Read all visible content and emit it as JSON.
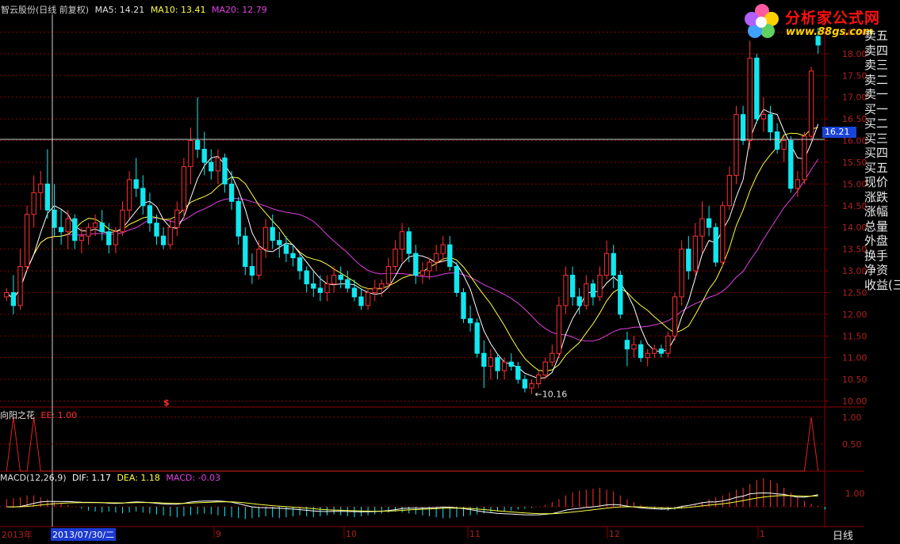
{
  "header": {
    "title": "智云股份(日线 前复权)",
    "ma5": "MA5: 14.21",
    "ma10": "MA10: 13.41",
    "ma20": "MA20: 12.79"
  },
  "logo": {
    "text": "分析家公式网",
    "url": "www.88gs.com"
  },
  "side_panel": {
    "items": [
      "卖五",
      "卖四",
      "卖三",
      "卖二",
      "卖一",
      "买一",
      "买二",
      "买三",
      "买四",
      "买五",
      "现价",
      "涨跌",
      "涨幅",
      "总量",
      "外盘",
      "换手",
      "净资",
      "收益(三"
    ]
  },
  "price_tag": "16.21",
  "low_label": "←10.16",
  "marker": "$",
  "indicator": {
    "name": "向阳之花",
    "value": "EE: 1.00"
  },
  "macd_header": {
    "name": "MACD(12,26,9)",
    "dif": "DIF: 1.17",
    "dea": "DEA: 1.18",
    "macd": "MACD: -0.03"
  },
  "timeline": {
    "year": "2013年",
    "date": "2013/07/30/二",
    "months": [
      "9",
      "10",
      "11",
      "12",
      "1"
    ],
    "period": "日线"
  },
  "colors": {
    "up": "#ff3030",
    "down": "#10e8f0",
    "ma5": "#ffffff",
    "ma10": "#ffff40",
    "ma20": "#e040e0",
    "grid": "#8b0000",
    "indicator": "#e02020"
  },
  "chart_data": {
    "type": "candlestick",
    "price_axis": {
      "ticks": [
        "18.50",
        "18.00",
        "17.50",
        "17.00",
        "16.50",
        "16.00",
        "15.50",
        "15.00",
        "14.50",
        "14.00",
        "13.50",
        "13.00",
        "12.50",
        "12.00",
        "11.50",
        "11.00",
        "10.50",
        "10.00"
      ],
      "ylim": [
        9.9,
        18.8
      ]
    },
    "indicator_axis": {
      "ticks": [
        "1.00",
        "0.50"
      ],
      "ylim": [
        0,
        1.1
      ]
    },
    "macd_axis": {
      "ticks": [
        "1.00"
      ]
    },
    "candles": [
      [
        12.4,
        12.6,
        12.3,
        12.5
      ],
      [
        12.5,
        12.9,
        12.0,
        12.2
      ],
      [
        12.2,
        13.5,
        12.1,
        13.1
      ],
      [
        13.1,
        14.5,
        13.0,
        14.3
      ],
      [
        14.3,
        15.2,
        14.0,
        14.8
      ],
      [
        14.8,
        15.3,
        14.4,
        15.0
      ],
      [
        15.0,
        15.8,
        14.2,
        14.4
      ],
      [
        14.4,
        15.0,
        13.8,
        14.0
      ],
      [
        14.0,
        14.4,
        13.6,
        13.9
      ],
      [
        13.9,
        14.4,
        13.5,
        14.2
      ],
      [
        14.2,
        14.3,
        13.5,
        13.7
      ],
      [
        13.7,
        14.0,
        13.4,
        13.8
      ],
      [
        13.8,
        14.1,
        13.6,
        14.0
      ],
      [
        14.0,
        14.3,
        13.8,
        14.1
      ],
      [
        14.1,
        14.4,
        13.7,
        13.9
      ],
      [
        13.9,
        14.1,
        13.4,
        13.6
      ],
      [
        13.6,
        14.0,
        13.4,
        13.9
      ],
      [
        13.9,
        14.6,
        13.8,
        14.4
      ],
      [
        14.4,
        15.3,
        14.2,
        15.1
      ],
      [
        15.1,
        15.6,
        14.7,
        14.9
      ],
      [
        14.9,
        15.2,
        14.3,
        14.5
      ],
      [
        14.5,
        14.8,
        13.9,
        14.1
      ],
      [
        14.1,
        14.3,
        13.6,
        13.8
      ],
      [
        13.8,
        14.0,
        13.5,
        13.6
      ],
      [
        13.6,
        14.2,
        13.5,
        14.0
      ],
      [
        14.0,
        14.6,
        13.8,
        14.4
      ],
      [
        14.4,
        15.6,
        14.2,
        15.4
      ],
      [
        15.4,
        16.3,
        15.0,
        16.0
      ],
      [
        16.0,
        17.0,
        15.6,
        15.8
      ],
      [
        15.8,
        16.2,
        15.2,
        15.5
      ],
      [
        15.5,
        15.8,
        15.1,
        15.3
      ],
      [
        15.3,
        15.8,
        15.0,
        15.6
      ],
      [
        15.6,
        15.7,
        14.8,
        15.0
      ],
      [
        15.0,
        15.3,
        14.4,
        14.6
      ],
      [
        14.6,
        14.7,
        13.6,
        13.8
      ],
      [
        13.8,
        14.0,
        12.9,
        13.1
      ],
      [
        13.1,
        13.4,
        12.7,
        12.9
      ],
      [
        12.9,
        13.7,
        12.8,
        13.5
      ],
      [
        13.5,
        14.2,
        13.3,
        14.0
      ],
      [
        14.0,
        14.3,
        13.5,
        13.7
      ],
      [
        13.7,
        13.9,
        13.3,
        13.6
      ],
      [
        13.6,
        13.8,
        13.2,
        13.4
      ],
      [
        13.4,
        13.6,
        13.1,
        13.3
      ],
      [
        13.3,
        13.4,
        12.8,
        13.0
      ],
      [
        13.0,
        13.1,
        12.5,
        12.7
      ],
      [
        12.7,
        13.0,
        12.4,
        12.6
      ],
      [
        12.6,
        12.9,
        12.3,
        12.5
      ],
      [
        12.5,
        12.9,
        12.3,
        12.7
      ],
      [
        12.7,
        13.1,
        12.5,
        12.9
      ],
      [
        12.9,
        13.1,
        12.6,
        12.8
      ],
      [
        12.8,
        13.0,
        12.5,
        12.6
      ],
      [
        12.6,
        12.8,
        12.3,
        12.4
      ],
      [
        12.4,
        12.6,
        12.1,
        12.2
      ],
      [
        12.2,
        12.6,
        12.1,
        12.5
      ],
      [
        12.5,
        12.8,
        12.3,
        12.6
      ],
      [
        12.6,
        12.8,
        12.4,
        12.7
      ],
      [
        12.7,
        13.3,
        12.6,
        13.1
      ],
      [
        13.1,
        13.7,
        13.0,
        13.5
      ],
      [
        13.5,
        14.1,
        13.2,
        13.9
      ],
      [
        13.9,
        14.0,
        13.2,
        13.4
      ],
      [
        13.4,
        13.6,
        12.7,
        12.9
      ],
      [
        12.9,
        13.2,
        12.7,
        13.0
      ],
      [
        13.0,
        13.3,
        12.8,
        13.2
      ],
      [
        13.2,
        13.6,
        13.0,
        13.4
      ],
      [
        13.4,
        13.8,
        13.2,
        13.6
      ],
      [
        13.6,
        13.8,
        13.0,
        13.1
      ],
      [
        13.1,
        13.2,
        12.4,
        12.5
      ],
      [
        12.5,
        12.6,
        11.8,
        11.9
      ],
      [
        11.9,
        12.2,
        11.6,
        11.8
      ],
      [
        11.8,
        11.9,
        11.0,
        11.1
      ],
      [
        11.1,
        11.4,
        10.3,
        10.8
      ],
      [
        10.8,
        11.2,
        10.5,
        11.0
      ],
      [
        11.0,
        11.1,
        10.5,
        10.7
      ],
      [
        10.7,
        11.0,
        10.5,
        10.9
      ],
      [
        10.9,
        11.1,
        10.7,
        10.8
      ],
      [
        10.8,
        10.9,
        10.4,
        10.5
      ],
      [
        10.5,
        10.6,
        10.2,
        10.3
      ],
      [
        10.3,
        10.5,
        10.16,
        10.4
      ],
      [
        10.4,
        10.7,
        10.3,
        10.6
      ],
      [
        10.6,
        11.0,
        10.5,
        10.9
      ],
      [
        10.9,
        11.3,
        10.8,
        11.1
      ],
      [
        11.1,
        12.4,
        11.0,
        12.2
      ],
      [
        12.2,
        13.1,
        12.0,
        12.9
      ],
      [
        12.9,
        13.1,
        12.2,
        12.4
      ],
      [
        12.4,
        12.6,
        12.0,
        12.2
      ],
      [
        12.2,
        12.9,
        12.1,
        12.7
      ],
      [
        12.7,
        12.8,
        12.2,
        12.4
      ],
      [
        12.4,
        13.1,
        12.3,
        12.9
      ],
      [
        12.9,
        13.7,
        12.8,
        13.4
      ],
      [
        13.4,
        13.6,
        12.6,
        12.9
      ],
      [
        12.9,
        13.0,
        11.9,
        12.0
      ],
      [
        11.4,
        11.6,
        10.8,
        11.2
      ],
      [
        11.2,
        11.5,
        11.0,
        11.3
      ],
      [
        11.3,
        11.4,
        10.9,
        11.0
      ],
      [
        11.0,
        11.2,
        10.8,
        11.1
      ],
      [
        11.1,
        11.3,
        11.0,
        11.2
      ],
      [
        11.2,
        11.3,
        11.0,
        11.1
      ],
      [
        11.1,
        11.6,
        11.0,
        11.5
      ],
      [
        11.5,
        12.5,
        11.4,
        12.4
      ],
      [
        12.4,
        13.7,
        12.2,
        13.5
      ],
      [
        13.5,
        13.8,
        12.8,
        13.0
      ],
      [
        13.0,
        14.1,
        12.9,
        13.8
      ],
      [
        13.8,
        14.6,
        13.4,
        14.2
      ],
      [
        14.2,
        14.5,
        13.8,
        14.0
      ],
      [
        14.0,
        14.1,
        13.1,
        13.2
      ],
      [
        13.2,
        14.6,
        13.1,
        14.5
      ],
      [
        14.5,
        15.4,
        14.4,
        15.2
      ],
      [
        15.2,
        16.8,
        15.0,
        16.6
      ],
      [
        16.6,
        16.8,
        15.9,
        16.0
      ],
      [
        16.0,
        18.3,
        15.8,
        17.9
      ],
      [
        17.9,
        18.0,
        16.4,
        16.5
      ],
      [
        16.5,
        17.0,
        16.2,
        16.6
      ],
      [
        16.6,
        16.8,
        16.0,
        16.2
      ],
      [
        16.2,
        16.4,
        15.7,
        15.8
      ],
      [
        15.8,
        16.1,
        15.5,
        16.0
      ],
      [
        16.0,
        16.1,
        14.8,
        14.9
      ],
      [
        14.9,
        15.3,
        14.7,
        15.1
      ],
      [
        15.1,
        16.2,
        15.0,
        16.1
      ],
      [
        16.1,
        17.7,
        16.0,
        17.6
      ],
      [
        18.4,
        18.6,
        18.0,
        18.2
      ]
    ],
    "indicator_values_at_candles": [
      [
        1,
        1.0
      ],
      [
        4,
        1.0
      ],
      [
        118,
        1.0
      ]
    ],
    "macd_hist": [
      0.08,
      0.09,
      0.1,
      0.12,
      0.12,
      0.1,
      0.08,
      0.06,
      0.04,
      0.02,
      0,
      -0.02,
      -0.04,
      -0.05,
      -0.06,
      -0.05,
      -0.06,
      -0.07,
      -0.06,
      -0.05,
      -0.06,
      -0.07,
      -0.08,
      -0.09,
      -0.1,
      -0.11,
      -0.1,
      -0.09,
      -0.08,
      -0.07,
      -0.08,
      -0.09,
      -0.1,
      -0.11,
      -0.12,
      -0.13,
      -0.12,
      -0.11,
      -0.1,
      -0.11,
      -0.12,
      -0.11,
      -0.1,
      -0.09,
      -0.1,
      -0.11,
      -0.1,
      -0.09,
      -0.08,
      -0.09,
      -0.1,
      -0.11,
      -0.1,
      -0.09,
      -0.08,
      -0.07,
      -0.06,
      -0.05,
      -0.06,
      -0.07,
      -0.08,
      -0.09,
      -0.1,
      -0.11,
      -0.12,
      -0.12,
      -0.11,
      -0.1,
      -0.09,
      -0.08,
      -0.07,
      -0.06,
      -0.05,
      -0.05,
      -0.04,
      -0.03,
      -0.02,
      -0.01,
      0,
      0.02,
      0.05,
      0.08,
      0.12,
      0.15,
      0.17,
      0.18,
      0.19,
      0.2,
      0.18,
      0.16,
      0.12,
      0.08,
      0.05,
      0.02,
      0,
      -0.02,
      -0.03,
      -0.04,
      -0.03,
      -0.02,
      0,
      0.02,
      0.05,
      0.08,
      0.1,
      0.12,
      0.15,
      0.18,
      0.2,
      0.24,
      0.28,
      0.3,
      0.28,
      0.25,
      0.2,
      0.15,
      0.1,
      0.06,
      0.03,
      0.01,
      -0.03
    ]
  }
}
